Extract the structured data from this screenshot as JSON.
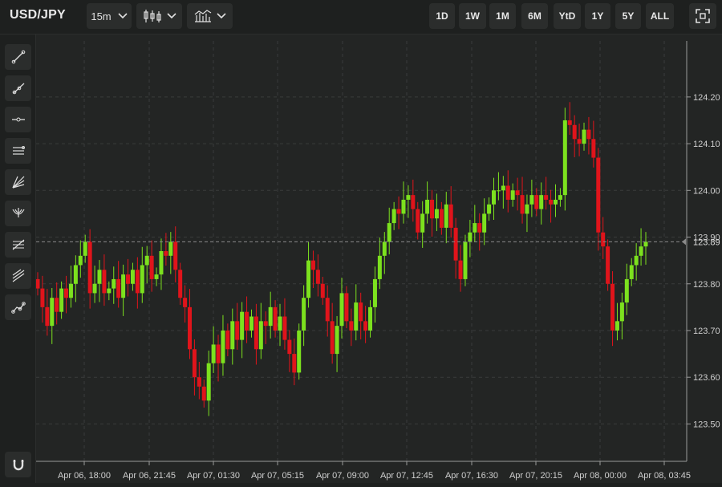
{
  "header": {
    "symbol": "USD/JPY",
    "interval": "15m",
    "chart_type_icon": "candlestick-icon",
    "indicators_icon": "indicators-icon",
    "fullscreen_icon": "fullscreen-icon"
  },
  "ranges": [
    "1D",
    "1W",
    "1M",
    "6M",
    "YtD",
    "1Y",
    "5Y",
    "ALL"
  ],
  "tools": [
    {
      "name": "trend-line-icon"
    },
    {
      "name": "ray-line-icon"
    },
    {
      "name": "horizontal-line-icon"
    },
    {
      "name": "parallel-channel-icon"
    },
    {
      "name": "fan-icon"
    },
    {
      "name": "pitchfork-icon"
    },
    {
      "name": "fibonacci-icon"
    },
    {
      "name": "regression-channel-icon"
    },
    {
      "name": "path-icon"
    },
    {
      "name": "magnet-icon"
    }
  ],
  "colors": {
    "up": "#7ce11e",
    "down": "#e0141b",
    "grid": "#3a3c3b",
    "text": "#cfcfcf",
    "bg": "#232524"
  },
  "chart_data": {
    "type": "candlestick",
    "series_name": "USD/JPY",
    "y_ticks": [
      "124.20",
      "124.10",
      "124.00",
      "123.90",
      "123.80",
      "123.70",
      "123.60",
      "123.50"
    ],
    "ylim": [
      123.42,
      124.32
    ],
    "x_ticks": [
      "Apr 06, 18:00",
      "Apr 06, 21:45",
      "Apr 07, 01:30",
      "Apr 07, 05:15",
      "Apr 07, 09:00",
      "Apr 07, 12:45",
      "Apr 07, 16:30",
      "Apr 07, 20:15",
      "Apr 08, 00:00",
      "Apr 08, 03:45"
    ],
    "last_price": "123.89",
    "last_price_value": 123.89,
    "last_price_marker": "123.90",
    "closes": [
      123.79,
      123.75,
      123.71,
      123.77,
      123.74,
      123.79,
      123.77,
      123.8,
      123.84,
      123.86,
      123.89,
      123.78,
      123.8,
      123.83,
      123.78,
      123.79,
      123.81,
      123.77,
      123.82,
      123.8,
      123.83,
      123.78,
      123.84,
      123.86,
      123.81,
      123.82,
      123.87,
      123.86,
      123.89,
      123.83,
      123.77,
      123.75,
      123.66,
      123.6,
      123.58,
      123.55,
      123.63,
      123.67,
      123.63,
      123.7,
      123.66,
      123.72,
      123.68,
      123.74,
      123.7,
      123.73,
      123.66,
      123.72,
      123.71,
      123.75,
      123.7,
      123.73,
      123.68,
      123.65,
      123.61,
      123.7,
      123.77,
      123.85,
      123.83,
      123.8,
      123.77,
      123.72,
      123.65,
      123.71,
      123.78,
      123.72,
      123.7,
      123.76,
      123.72,
      123.7,
      123.75,
      123.81,
      123.86,
      123.89,
      123.93,
      123.96,
      123.95,
      123.98,
      123.99,
      123.96,
      123.91,
      123.95,
      123.98,
      123.94,
      123.96,
      123.92,
      123.97,
      123.92,
      123.85,
      123.81,
      123.89,
      123.91,
      123.93,
      123.91,
      123.95,
      123.97,
      124.0,
      124.0,
      124.01,
      123.98,
      124.0,
      123.99,
      123.95,
      123.97,
      123.99,
      123.96,
      123.99,
      123.98,
      123.97,
      123.98,
      123.99,
      124.15,
      124.14,
      124.11,
      124.1,
      124.13,
      124.11,
      124.07,
      123.91,
      123.88,
      123.8,
      123.7,
      123.72,
      123.76,
      123.81,
      123.84,
      123.86,
      123.88,
      123.89
    ]
  }
}
